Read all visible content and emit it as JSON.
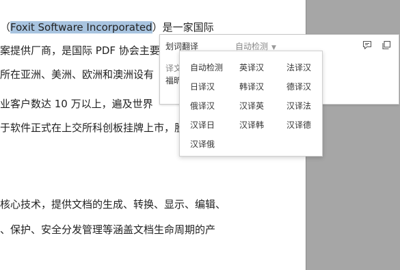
{
  "document": {
    "line1_pre": "（",
    "line1_highlight": "Foxit Software Incorporated",
    "line1_post": "）是一家国际",
    "line2": "案提供厂商，是国际 PDF 协会主要",
    "line3": "所在亚洲、美洲、欧洲和澳洲设有",
    "line4": "业客户数达 10 万以上，遍及世界",
    "line5": "于软件正式在上交所科创板挂牌上市，股",
    "line6": "核心技术，提供文档的生成、转换、显示、编辑、",
    "line7": "、保护、安全分发管理等涵盖文档生命周期的产"
  },
  "popup": {
    "title": "划词翻译",
    "language_selected": "自动检测",
    "result_label_partial": "译文",
    "result_text_partial": "福昕"
  },
  "dropdown": {
    "options": [
      "自动检测",
      "英译汉",
      "法译汉",
      "日译汉",
      "韩译汉",
      "德译汉",
      "俄译汉",
      "汉译英",
      "汉译法",
      "汉译日",
      "汉译韩",
      "汉译德",
      "汉译俄"
    ]
  },
  "icons": {
    "comment": "comment-icon",
    "copy": "copy-icon"
  },
  "colors": {
    "highlight": "#a8c4e0",
    "side_panel": "#a6a6a6"
  }
}
